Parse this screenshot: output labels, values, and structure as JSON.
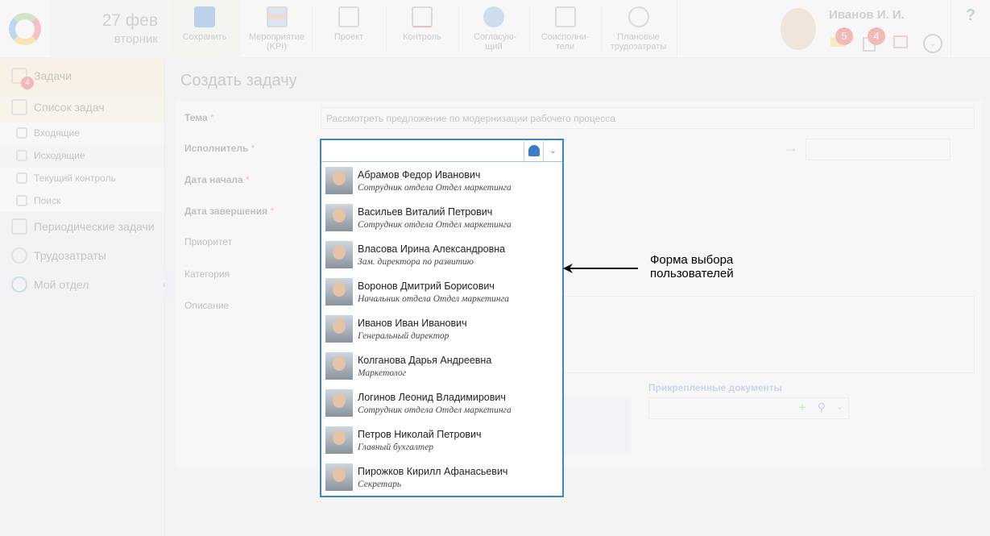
{
  "header": {
    "date": "27 фев",
    "weekday": "вторник",
    "user_name": "Иванов И. И.",
    "mail_badge": "5",
    "task_badge": "4",
    "help": "?"
  },
  "toolbar": [
    {
      "label": "Сохранить"
    },
    {
      "label": "Мероприятие (KPI)"
    },
    {
      "label": "Проект"
    },
    {
      "label": "Контроль"
    },
    {
      "label": "Согласую-щий"
    },
    {
      "label": "Соисполни-тели"
    },
    {
      "label": "Плановые трудозатраты"
    }
  ],
  "sidebar": {
    "tasks": "Задачи",
    "tasks_badge": "4",
    "task_list": "Список задач",
    "sub": [
      "Входящие",
      "Исходящие",
      "Текущий контроль",
      "Поиск"
    ],
    "periodic": "Периодические задачи",
    "labor": "Трудозатраты",
    "dept": "Мой отдел"
  },
  "form": {
    "title": "Создать задачу",
    "topic_label": "Тема",
    "topic_value": "Рассмотреть предложение по модернизации рабочего процесса",
    "executor": "Исполнитель",
    "start": "Дата начала",
    "end": "Дата завершения",
    "priority": "Приоритет",
    "category": "Категория",
    "description": "Описание",
    "attached": "Прикрепленные документы",
    "req": "*"
  },
  "dropdown": [
    {
      "name": "Абрамов Федор Иванович",
      "pos": "Сотрудник отдела Отдел маркетинга"
    },
    {
      "name": "Васильев Виталий Петрович",
      "pos": "Сотрудник отдела Отдел маркетинга"
    },
    {
      "name": "Власова Ирина Александровна",
      "pos": "Зам. директора по развитию"
    },
    {
      "name": "Воронов Дмитрий Борисович",
      "pos": "Начальник отдела Отдел маркетинга"
    },
    {
      "name": "Иванов Иван Иванович",
      "pos": "Генеральный директор"
    },
    {
      "name": "Колганова Дарья Андреевна",
      "pos": "Маркетолог"
    },
    {
      "name": "Логинов Леонид Владимирович",
      "pos": "Сотрудник отдела Отдел маркетинга"
    },
    {
      "name": "Петров Николай Петрович",
      "pos": "Главный бухгалтер"
    },
    {
      "name": "Пирожков Кирилл Афанасьевич",
      "pos": "Секретарь"
    }
  ],
  "annotation": {
    "line1": "Форма выбора",
    "line2": "пользователей"
  }
}
